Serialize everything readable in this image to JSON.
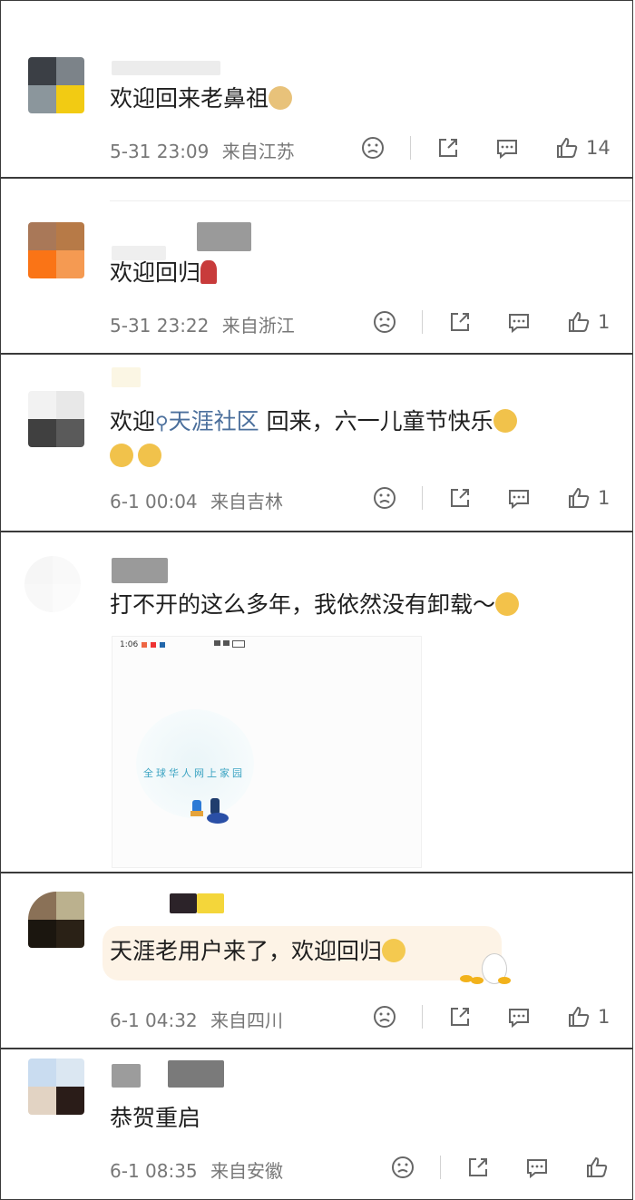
{
  "comments": [
    {
      "text": "欢迎回来老鼻祖",
      "date": "5-31 23:09",
      "location": "来自江苏",
      "likes": "14",
      "emoji": "doge-emoji"
    },
    {
      "text": "欢迎回归",
      "date": "5-31 23:22",
      "location": "来自浙江",
      "likes": "1",
      "emoji": "rose-emoji"
    },
    {
      "text_prefix": "欢迎",
      "topic": "天涯社区",
      "text_suffix": " 回来，六一儿童节快乐",
      "date": "6-1 00:04",
      "location": "来自吉林",
      "likes": "1",
      "emoji": "cheer-emoji"
    },
    {
      "text": "打不开的这么多年，我依然没有卸载～",
      "date": "",
      "location": "",
      "likes": "",
      "emoji": "flower-face-emoji",
      "screenshot": {
        "status_time": "1:06",
        "tagline": "全球华人网上家园"
      }
    },
    {
      "text": "天涯老用户来了，欢迎回归",
      "date": "6-1 04:32",
      "location": "来自四川",
      "likes": "1",
      "emoji": "shy-emoji"
    },
    {
      "text": "恭贺重启",
      "date": "6-1 08:35",
      "location": "来自安徽",
      "likes": "",
      "emoji": ""
    }
  ],
  "icons": {
    "dislike": "dislike-face-icon",
    "share": "share-icon",
    "comment": "comment-icon",
    "like": "thumbs-up-icon",
    "search": "search-icon"
  },
  "colors": {
    "topic": "#4b6f9c",
    "meta": "#777777"
  }
}
